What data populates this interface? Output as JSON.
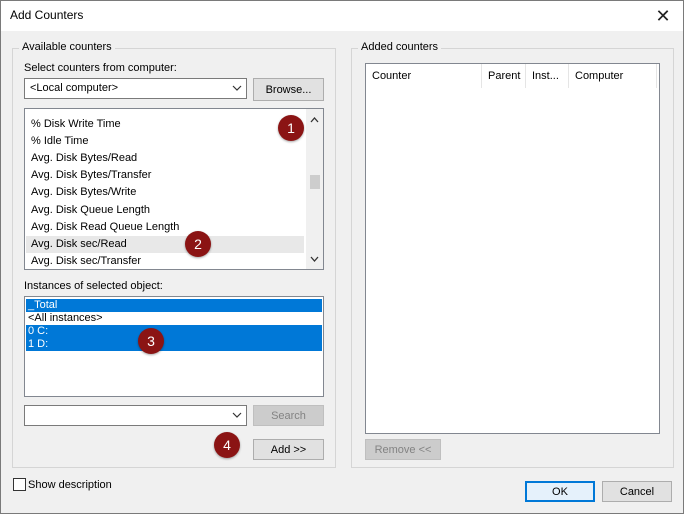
{
  "window": {
    "title": "Add Counters"
  },
  "available": {
    "group_label": "Available counters",
    "computer_label": "Select counters from computer:",
    "computer_value": "<Local computer>",
    "browse_label": "Browse...",
    "counters": [
      "% Disk Write Time",
      "% Idle Time",
      "Avg. Disk Bytes/Read",
      "Avg. Disk Bytes/Transfer",
      "Avg. Disk Bytes/Write",
      "Avg. Disk Queue Length",
      "Avg. Disk Read Queue Length",
      "Avg. Disk sec/Read",
      "Avg. Disk sec/Transfer"
    ],
    "instances_label": "Instances of selected object:",
    "instances": [
      "_Total",
      "<All instances>",
      "0 C:",
      "1 D:"
    ],
    "search_value": "",
    "search_label": "Search",
    "add_label": "Add >>"
  },
  "added": {
    "group_label": "Added counters",
    "columns": [
      "Counter",
      "Parent",
      "Inst...",
      "Computer"
    ],
    "remove_label": "Remove <<"
  },
  "footer": {
    "show_description_label": "Show description",
    "ok_label": "OK",
    "cancel_label": "Cancel"
  },
  "callouts": [
    "1",
    "2",
    "3",
    "4"
  ],
  "colors": {
    "selection": "#0078d7",
    "callout": "#8b1414"
  },
  "icons": [
    "close-icon",
    "chevron-down-icon",
    "scroll-up-icon",
    "scroll-down-icon"
  ]
}
